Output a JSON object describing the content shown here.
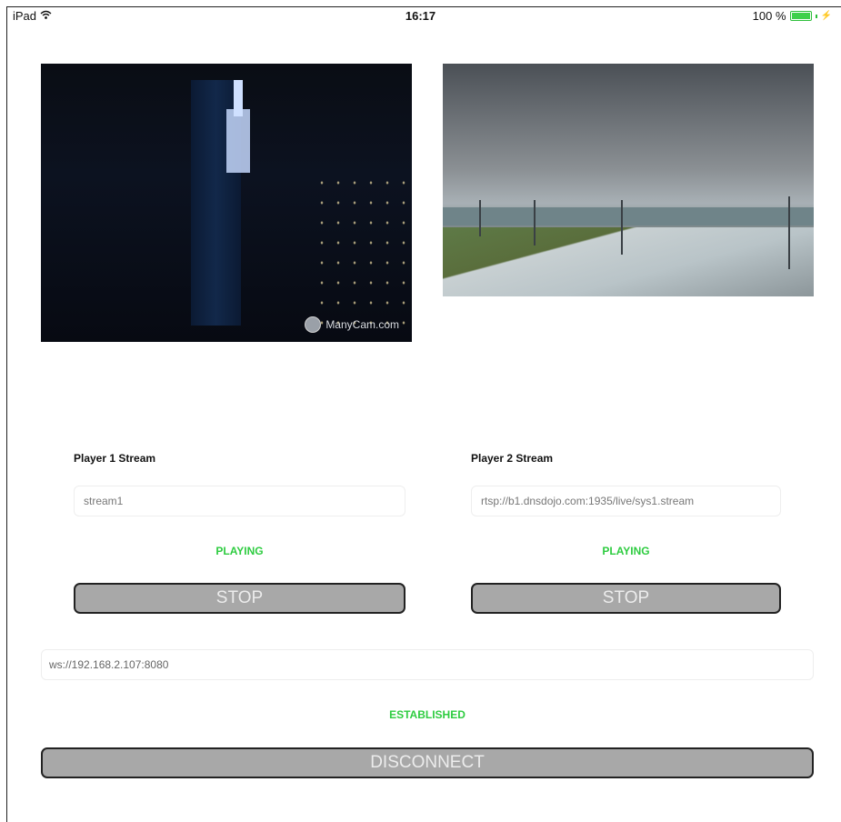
{
  "status_bar": {
    "device": "iPad",
    "wifi_icon": "wifi-icon",
    "time": "16:17",
    "battery": "100 %",
    "battery_level": 1.0
  },
  "player1": {
    "watermark": "ManyCam.com",
    "label": "Player 1 Stream",
    "stream_value": "stream1",
    "status": "PLAYING",
    "button": "STOP"
  },
  "player2": {
    "label": "Player 2 Stream",
    "stream_value": "rtsp://b1.dnsdojo.com:1935/live/sys1.stream",
    "status": "PLAYING",
    "button": "STOP"
  },
  "connection": {
    "url": "ws://192.168.2.107:8080",
    "status": "ESTABLISHED",
    "button": "DISCONNECT"
  },
  "colors": {
    "status_green": "#2ecc40",
    "button_gray": "#a8a8a8"
  }
}
